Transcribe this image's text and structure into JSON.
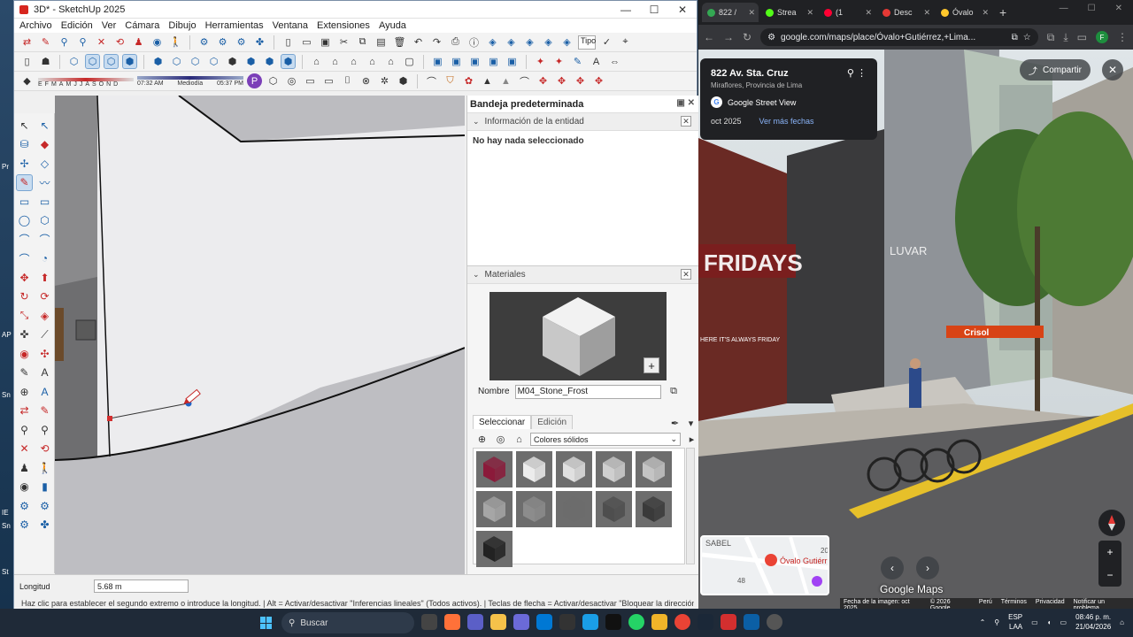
{
  "desktop": {
    "labels": [
      "Pr",
      "AP",
      "Sn",
      "IE",
      "Sn",
      "St"
    ]
  },
  "sketchup": {
    "title": "3D* - SketchUp 2025",
    "window_controls": [
      "—",
      "☐",
      "✕"
    ],
    "menu": [
      "Archivo",
      "Edición",
      "Ver",
      "Cámara",
      "Dibujo",
      "Herramientas",
      "Ventana",
      "Extensiones",
      "Ayuda"
    ],
    "tipo_input": "Tipo",
    "months": [
      "E",
      "F",
      "M",
      "A",
      "M",
      "J",
      "J",
      "A",
      "S",
      "O",
      "N",
      "D"
    ],
    "shadow_times": {
      "start": "07:32 AM",
      "mid": "Mediodía",
      "end": "05:37 PM"
    },
    "tray": {
      "title": "Bandeja predeterminada",
      "entity_panel": {
        "title": "Información de la entidad",
        "empty_text": "No hay nada seleccionado"
      },
      "materials_panel": {
        "title": "Materiales",
        "name_label": "Nombre",
        "name_value": "M04_Stone_Frost",
        "tabs": [
          "Seleccionar",
          "Edición"
        ],
        "library": "Colores sólidos",
        "swatches": [
          "#8b1a3a",
          "#ececec",
          "#e0e0e0",
          "#cfcfcf",
          "#c4c4c4",
          "#a6a6a6",
          "#8c8c8c",
          "#6c6c6c",
          "#4e4e4e",
          "#3a3a3a",
          "#222222"
        ]
      }
    },
    "status": {
      "length_label": "Longitud",
      "length_value": "5.68 m",
      "hint": "Haz clic para establecer el segundo extremo o introduce la longitud. | Alt = Activar/desactivar \"Inferencias lineales\" (Todos activos). | Teclas de flecha = Activar/desactivar \"Bloquear la dirección de"
    }
  },
  "chrome": {
    "tabs": [
      {
        "title": "822 /",
        "color": "#34a853",
        "active": true
      },
      {
        "title": "Strea",
        "color": "#53fc18",
        "active": false
      },
      {
        "title": "(1",
        "color": "#ff0033",
        "active": false
      },
      {
        "title": "Desc",
        "color": "#e53935",
        "active": false
      },
      {
        "title": "Óvalo",
        "color": "#ffc72c",
        "active": false
      }
    ],
    "url": "google.com/maps/place/Óvalo+Gutiérrez,+Lima...",
    "profile_initial": "F",
    "streetview": {
      "address": "822 Av. Sta. Cruz",
      "locality": "Miraflores, Provincia de Lima",
      "source": "Google Street View",
      "date": "oct 2025",
      "more_dates": "Ver más fechas",
      "share": "Compartir",
      "minimap_place": "Óvalo Gutiérr",
      "minimap_texts": [
        "SABEL",
        "48",
        "20"
      ],
      "brand": "Google Maps",
      "signs": [
        "FRIDAYS",
        "LUVAR",
        "HERE IT'S ALWAYS FRIDAY",
        "Crisol"
      ],
      "footer": [
        "Fecha de la imagen: oct 2025",
        "© 2026 Google",
        "Perú",
        "Términos",
        "Privacidad",
        "Notificar un problema"
      ]
    }
  },
  "taskbar": {
    "search_placeholder": "Buscar",
    "lang": "ESP",
    "lang2": "LAA",
    "time": "08:46 p. m.",
    "date": "21/04/2026"
  }
}
